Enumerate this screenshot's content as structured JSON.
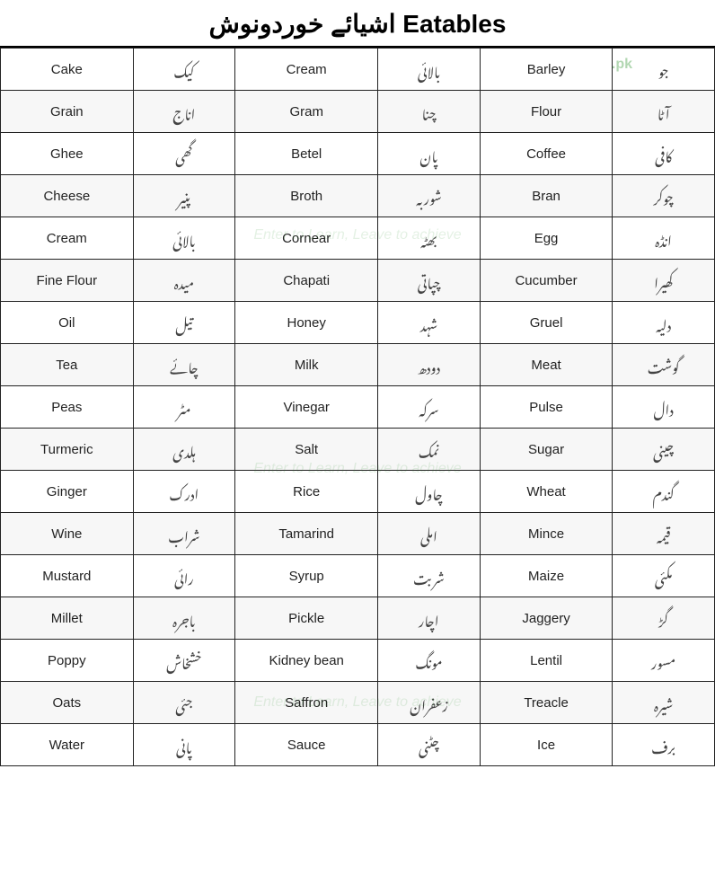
{
  "title": "اشیائے خوردونوش  Eatables",
  "watermark": "Enter to Learn, Leave to achieve",
  "logo": ".pk",
  "columns": [
    "en1",
    "ur1",
    "en2",
    "ur2",
    "en3",
    "ur3"
  ],
  "rows": [
    {
      "en1": "Cake",
      "ur1": "کیک",
      "en2": "Cream",
      "ur2": "بالائی",
      "en3": "Barley",
      "ur3": "جو"
    },
    {
      "en1": "Grain",
      "ur1": "اناج",
      "en2": "Gram",
      "ur2": "چنا",
      "en3": "Flour",
      "ur3": "آٹا"
    },
    {
      "en1": "Ghee",
      "ur1": "گھی",
      "en2": "Betel",
      "ur2": "پان",
      "en3": "Coffee",
      "ur3": "کافی"
    },
    {
      "en1": "Cheese",
      "ur1": "پنیر",
      "en2": "Broth",
      "ur2": "شوربہ",
      "en3": "Bran",
      "ur3": "چوکر"
    },
    {
      "en1": "Cream",
      "ur1": "بالائی",
      "en2": "Cornear",
      "ur2": "بھٹہ",
      "en3": "Egg",
      "ur3": "انڈہ"
    },
    {
      "en1": "Fine Flour",
      "ur1": "میدہ",
      "en2": "Chapati",
      "ur2": "چپاتی",
      "en3": "Cucumber",
      "ur3": "کھیرا"
    },
    {
      "en1": "Oil",
      "ur1": "تیل",
      "en2": "Honey",
      "ur2": "شہد",
      "en3": "Gruel",
      "ur3": "دلیہ"
    },
    {
      "en1": "Tea",
      "ur1": "چائے",
      "en2": "Milk",
      "ur2": "دودھ",
      "en3": "Meat",
      "ur3": "گوشت"
    },
    {
      "en1": "Peas",
      "ur1": "مٹر",
      "en2": "Vinegar",
      "ur2": "سرکہ",
      "en3": "Pulse",
      "ur3": "دال"
    },
    {
      "en1": "Turmeric",
      "ur1": "ہلدی",
      "en2": "Salt",
      "ur2": "نمک",
      "en3": "Sugar",
      "ur3": "چینی"
    },
    {
      "en1": "Ginger",
      "ur1": "ادرک",
      "en2": "Rice",
      "ur2": "چاول",
      "en3": "Wheat",
      "ur3": "گندم"
    },
    {
      "en1": "Wine",
      "ur1": "شراب",
      "en2": "Tamarind",
      "ur2": "املی",
      "en3": "Mince",
      "ur3": "قیمہ"
    },
    {
      "en1": "Mustard",
      "ur1": "رائی",
      "en2": "Syrup",
      "ur2": "شربت",
      "en3": "Maize",
      "ur3": "مکئی"
    },
    {
      "en1": "Millet",
      "ur1": "باجرہ",
      "en2": "Pickle",
      "ur2": "اچار",
      "en3": "Jaggery",
      "ur3": "گڑ"
    },
    {
      "en1": "Poppy",
      "ur1": "خشخاش",
      "en2": "Kidney bean",
      "ur2": "مونگ",
      "en3": "Lentil",
      "ur3": "مسور"
    },
    {
      "en1": "Oats",
      "ur1": "جئی",
      "en2": "Saffron",
      "ur2": "زعفران",
      "en3": "Treacle",
      "ur3": "شیرہ"
    },
    {
      "en1": "Water",
      "ur1": "پانی",
      "en2": "Sauce",
      "ur2": "چٹنی",
      "en3": "Ice",
      "ur3": "برف"
    }
  ]
}
